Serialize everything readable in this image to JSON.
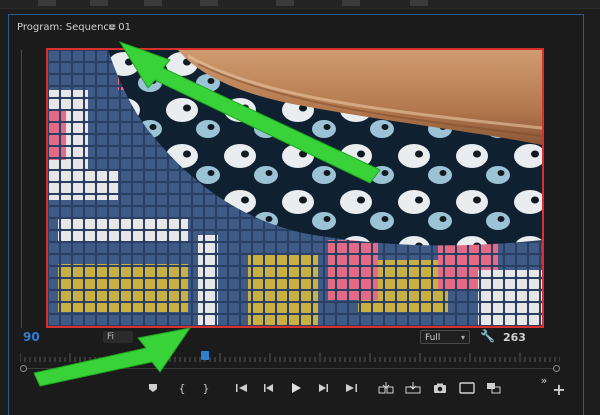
{
  "panel": {
    "title": "Program: Sequence 01",
    "menu_icon": "hamburger-icon"
  },
  "footer": {
    "zoom_value": "90",
    "small_button_label": "Fi",
    "resolution_select": "Full",
    "wrench_icon": "wrench-icon",
    "fit_value": "263"
  },
  "transport": {
    "buttons": [
      "marker-icon",
      "in-point-icon",
      "out-point-icon",
      "go-to-in-icon",
      "step-back-icon",
      "play-icon",
      "step-forward-icon",
      "go-to-out-icon",
      "insert-icon",
      "overwrite-icon",
      "export-frame-icon",
      "comparison-view-icon",
      "multicam-icon",
      "more-icon",
      "add-button"
    ]
  },
  "accent_colors": {
    "panel_border": "#2a5d91",
    "video_border": "#d8302e",
    "playhead": "#2f7fd0",
    "arrow": "#2fcf2f"
  }
}
